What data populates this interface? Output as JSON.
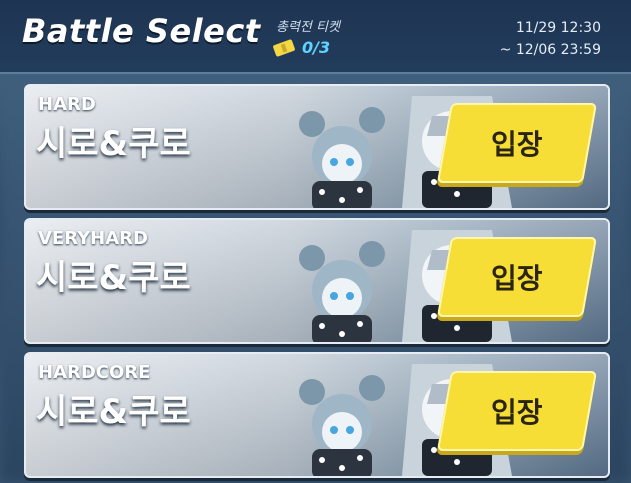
{
  "header": {
    "title": "Battle Select",
    "ticket_label": "총력전 티켓",
    "ticket_count": "0/3",
    "period_start": "11/29 12:30",
    "period_end": "~ 12/06 23:59"
  },
  "battles": [
    {
      "difficulty": "HARD",
      "name": "시로&쿠로",
      "button": "입장",
      "difficulty_color": "#ffffff"
    },
    {
      "difficulty": "VERYHARD",
      "name": "시로&쿠로",
      "button": "입장",
      "difficulty_color": "#ffffff"
    },
    {
      "difficulty": "HARDCORE",
      "name": "시로&쿠로",
      "button": "입장",
      "difficulty_color": "#ffffff"
    }
  ]
}
